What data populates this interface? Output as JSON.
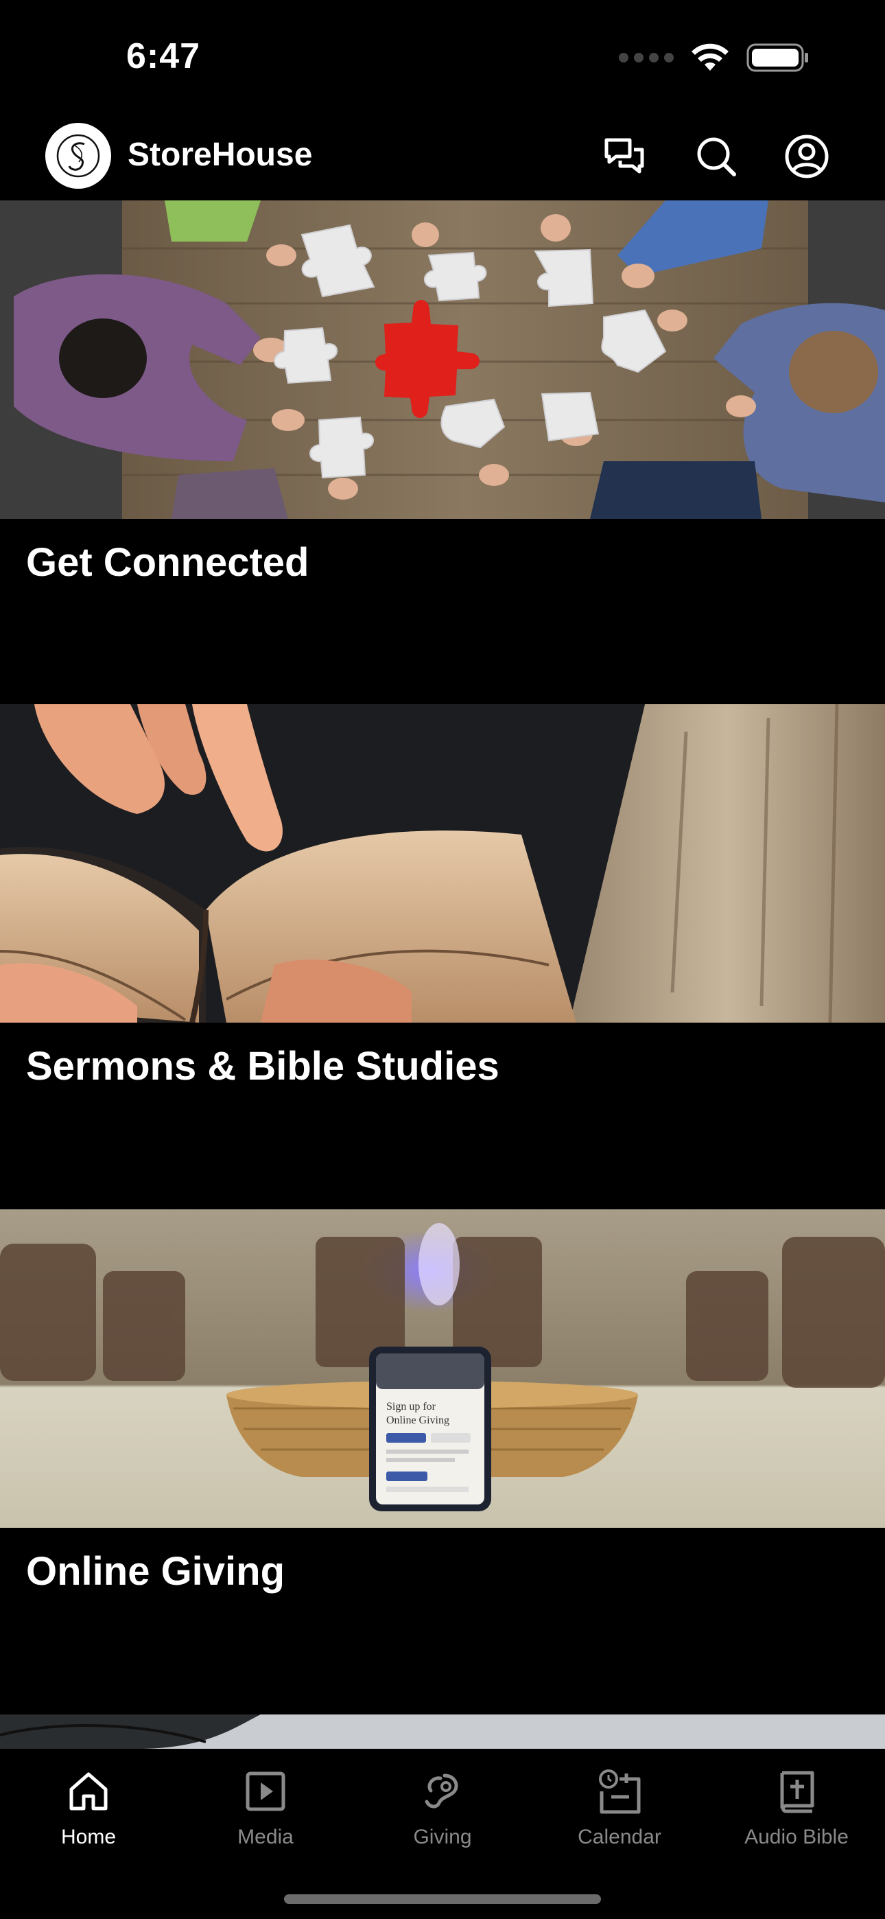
{
  "status_bar": {
    "time": "6:47"
  },
  "header": {
    "app_name": "StoreHouse",
    "icons": [
      "logo-icon",
      "chat-icon",
      "search-icon",
      "profile-icon"
    ]
  },
  "cards": [
    {
      "title": "Get Connected"
    },
    {
      "title": "Sermons & Bible Studies"
    },
    {
      "title": "Online Giving"
    }
  ],
  "giving_phone_screen": {
    "headline_1": "Sign up for",
    "headline_2": "Online Giving"
  },
  "tabs": [
    {
      "label": "Home",
      "icon": "home-icon",
      "active": true
    },
    {
      "label": "Media",
      "icon": "media-play-icon",
      "active": false
    },
    {
      "label": "Giving",
      "icon": "giving-icon",
      "active": false
    },
    {
      "label": "Calendar",
      "icon": "calendar-icon",
      "active": false
    },
    {
      "label": "Audio Bible",
      "icon": "bible-icon",
      "active": false
    }
  ],
  "colors": {
    "background": "#000000",
    "text": "#ffffff",
    "inactive_tab": "#8a8a8a",
    "puzzle_accent": "#e0201b"
  }
}
